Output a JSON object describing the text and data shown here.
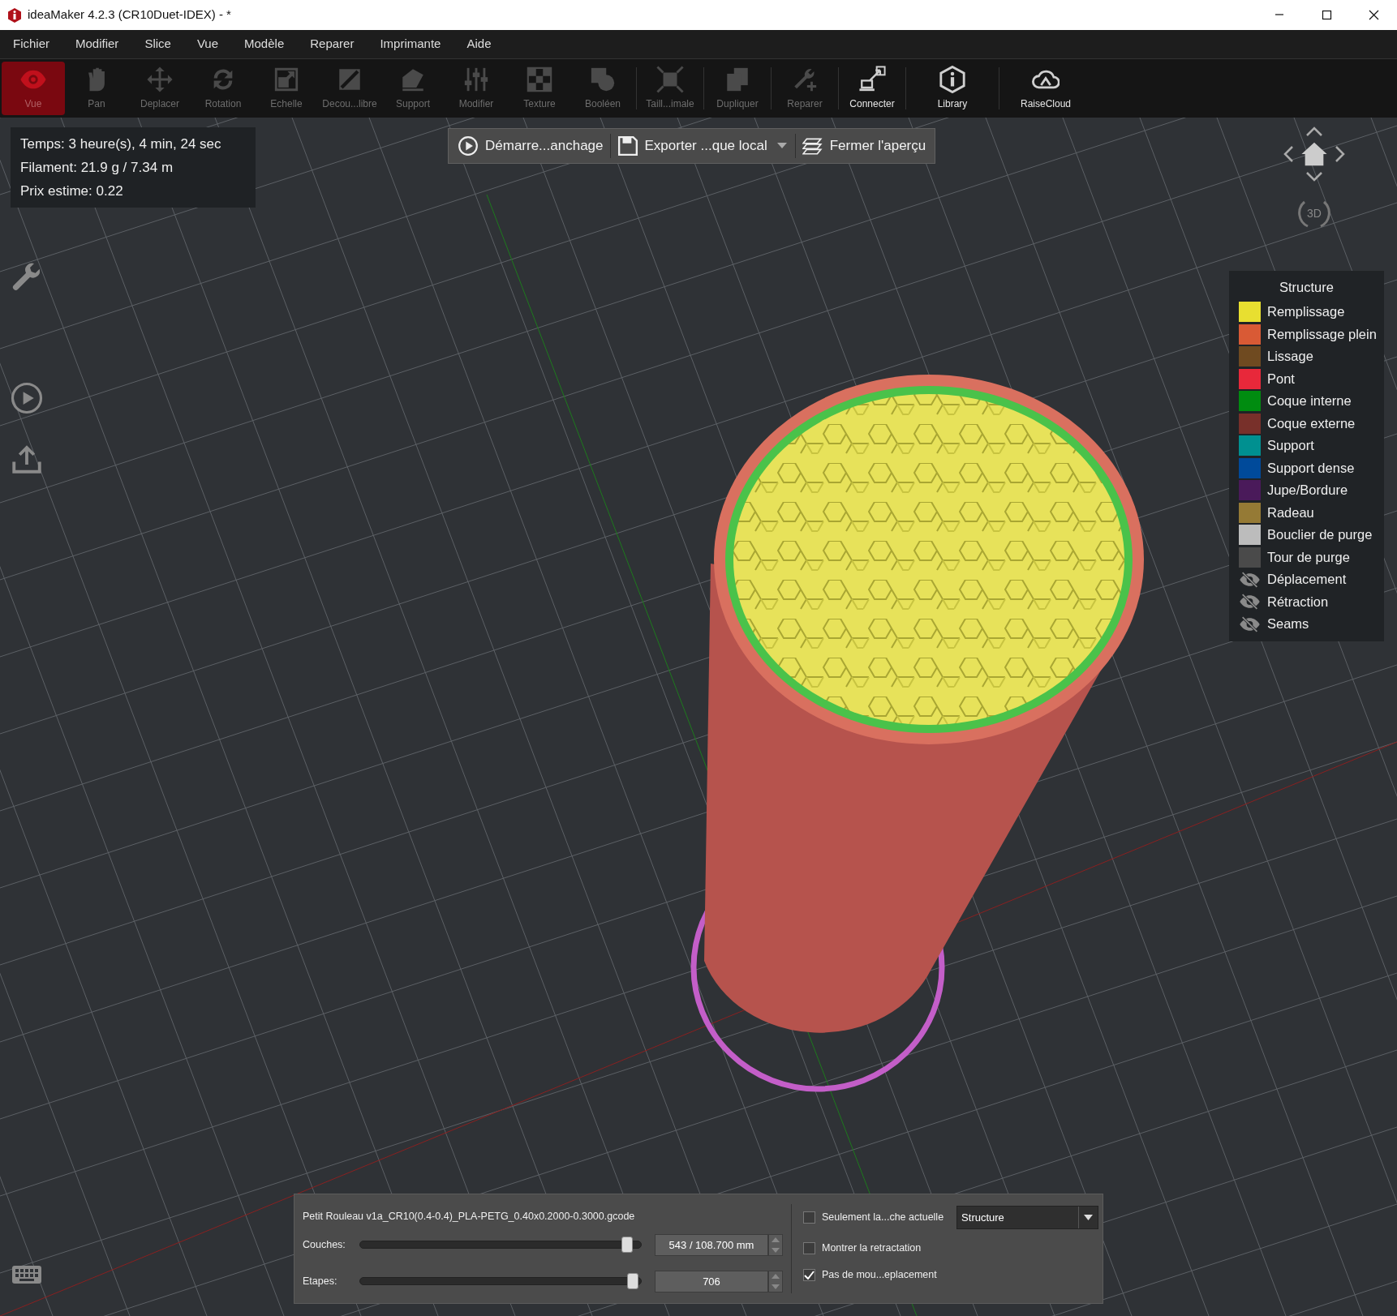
{
  "window": {
    "title": "ideaMaker 4.2.3 (CR10Duet-IDEX) - *"
  },
  "menu": [
    "Fichier",
    "Modifier",
    "Slice",
    "Vue",
    "Modèle",
    "Reparer",
    "Imprimante",
    "Aide"
  ],
  "toolbar": [
    {
      "label": "Vue",
      "selected": true,
      "disabled": false,
      "divider_before": false
    },
    {
      "label": "Pan",
      "selected": false,
      "disabled": true,
      "divider_before": false
    },
    {
      "label": "Deplacer",
      "selected": false,
      "disabled": true,
      "divider_before": false
    },
    {
      "label": "Rotation",
      "selected": false,
      "disabled": true,
      "divider_before": false
    },
    {
      "label": "Echelle",
      "selected": false,
      "disabled": true,
      "divider_before": false
    },
    {
      "label": "Decou...libre",
      "selected": false,
      "disabled": true,
      "divider_before": false
    },
    {
      "label": "Support",
      "selected": false,
      "disabled": true,
      "divider_before": false
    },
    {
      "label": "Modifier",
      "selected": false,
      "disabled": true,
      "divider_before": false
    },
    {
      "label": "Texture",
      "selected": false,
      "disabled": true,
      "divider_before": false
    },
    {
      "label": "Booléen",
      "selected": false,
      "disabled": true,
      "divider_before": false
    },
    {
      "label": "Taill...imale",
      "selected": false,
      "disabled": true,
      "divider_before": true
    },
    {
      "label": "Dupliquer",
      "selected": false,
      "disabled": true,
      "divider_before": true
    },
    {
      "label": "Reparer",
      "selected": false,
      "disabled": true,
      "divider_before": true
    },
    {
      "label": "Connecter",
      "selected": false,
      "disabled": false,
      "divider_before": true
    },
    {
      "label": "Library",
      "selected": false,
      "disabled": false,
      "divider_before": true
    },
    {
      "label": "RaiseCloud",
      "selected": false,
      "disabled": false,
      "divider_before": true
    }
  ],
  "stats": [
    "Temps: 3 heure(s), 4 min, 24 sec",
    "Filament: 21.9 g / 7.34 m",
    "Prix estime: 0.22"
  ],
  "actions": [
    {
      "label": "Démarre...anchage",
      "dropdown": false
    },
    {
      "label": "Exporter ...que local",
      "dropdown": true
    },
    {
      "label": "Fermer l'aperçu",
      "dropdown": false
    }
  ],
  "view_cube": {
    "label": "3D"
  },
  "legend": {
    "title": "Structure",
    "items": [
      {
        "kind": "swatch",
        "label": "Remplissage",
        "color": "#e8df30"
      },
      {
        "kind": "swatch",
        "label": "Remplissage plein",
        "color": "#d95a35"
      },
      {
        "kind": "swatch",
        "label": "Lissage",
        "color": "#6f4a20"
      },
      {
        "kind": "swatch",
        "label": "Pont",
        "color": "#e8283a"
      },
      {
        "kind": "swatch",
        "label": "Coque interne",
        "color": "#008c10"
      },
      {
        "kind": "swatch",
        "label": "Coque externe",
        "color": "#78302a"
      },
      {
        "kind": "swatch",
        "label": "Support",
        "color": "#009090"
      },
      {
        "kind": "swatch",
        "label": "Support dense",
        "color": "#004a9a"
      },
      {
        "kind": "swatch",
        "label": "Jupe/Bordure",
        "color": "#4a1a5a"
      },
      {
        "kind": "swatch",
        "label": "Radeau",
        "color": "#957a35"
      },
      {
        "kind": "swatch",
        "label": "Bouclier de purge",
        "color": "#bcbcbc"
      },
      {
        "kind": "swatch",
        "label": "Tour de purge",
        "color": "#4a4a4a"
      },
      {
        "kind": "hidden",
        "label": "Déplacement"
      },
      {
        "kind": "hidden",
        "label": "Rétraction"
      },
      {
        "kind": "hidden",
        "label": "Seams"
      }
    ]
  },
  "preview_panel": {
    "file": "Petit Rouleau v1a_CR10(0.4-0.4)_PLA-PETG_0.40x0.2000-0.3000.gcode",
    "sliders": [
      {
        "label": "Couches:",
        "level": 0.97,
        "value": "543 / 108.700 mm"
      },
      {
        "label": "Etapes:",
        "level": 0.99,
        "value": "706"
      }
    ],
    "options": [
      {
        "label": "Seulement la...che actuelle",
        "checked": false
      },
      {
        "label": "Montrer la retractation",
        "checked": false
      },
      {
        "label": "Pas de mou...eplacement",
        "checked": true
      }
    ],
    "mode": "Structure"
  }
}
